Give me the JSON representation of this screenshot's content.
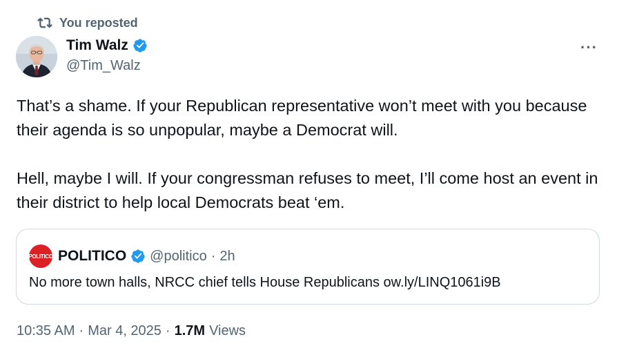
{
  "repost": {
    "icon": "repost-icon",
    "label": "You reposted"
  },
  "author": {
    "name": "Tim Walz",
    "handle": "@Tim_Walz",
    "verified": true,
    "verified_color": "#1d9bf0"
  },
  "more_label": "···",
  "tweet": {
    "paragraphs": [
      "That’s a shame. If your Republican representative won’t meet with you because their agenda is so unpopular, maybe a Democrat will.",
      "Hell, maybe I will. If your congressman refuses to meet, I’ll come host an event in their district to help local Democrats beat ‘em."
    ]
  },
  "quote": {
    "logo_text": "POLITICO",
    "logo_color": "#dc2126",
    "name": "POLITICO",
    "verified": true,
    "handle": "@politico",
    "separator": "·",
    "time": "2h",
    "text": "No more town halls, NRCC chief tells House Republicans ow.ly/LINQ1061i9B"
  },
  "meta": {
    "time": "10:35 AM",
    "sep1": "·",
    "date": "Mar 4, 2025",
    "sep2": "·",
    "views_count": "1.7M",
    "views_label": "Views"
  },
  "colors": {
    "text_primary": "#0f1419",
    "text_secondary": "#536471",
    "border": "#cfd9de"
  }
}
